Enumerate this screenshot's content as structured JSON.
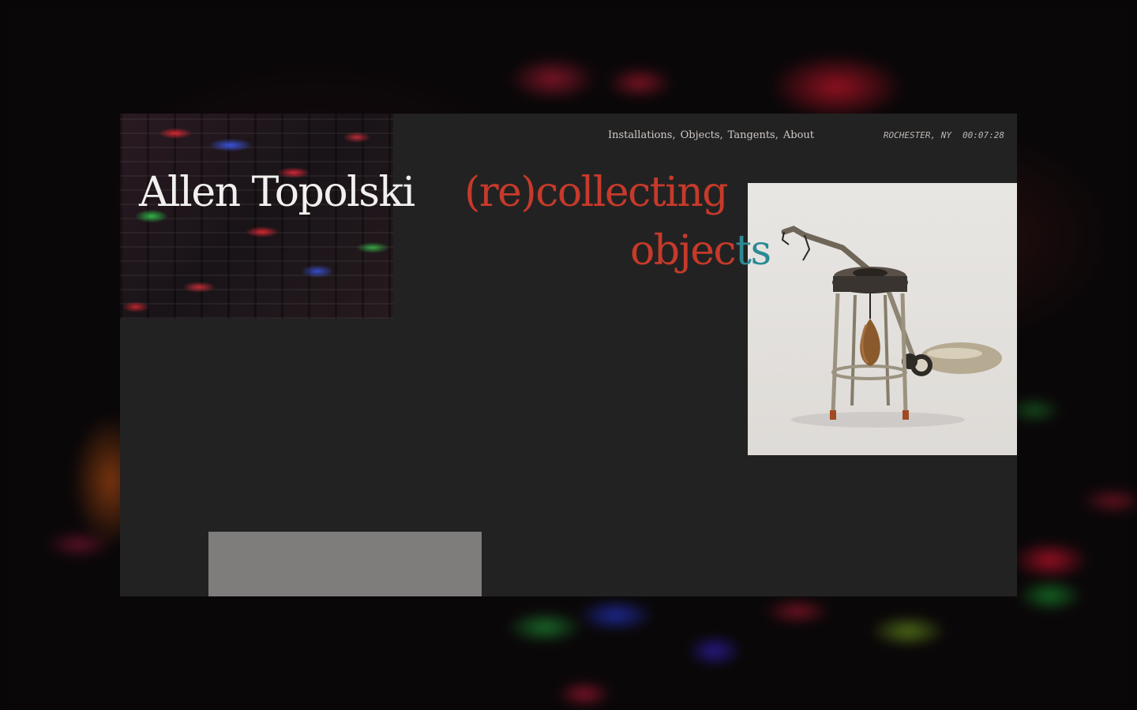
{
  "site": {
    "artist_name": "Allen Topolski",
    "title_line1": "(re)collecting",
    "title_line2_a": "objec",
    "title_line2_b": "ts"
  },
  "nav": {
    "items": [
      {
        "label": "Installations"
      },
      {
        "label": "Objects"
      },
      {
        "label": "Tangents"
      },
      {
        "label": "About"
      }
    ],
    "separator": ","
  },
  "header": {
    "location": "ROCHESTER, NY",
    "clock": "00:07:28"
  },
  "colors": {
    "title_red": "#c63a2b",
    "title_teal": "#2b8a94",
    "panel": "#232222"
  }
}
